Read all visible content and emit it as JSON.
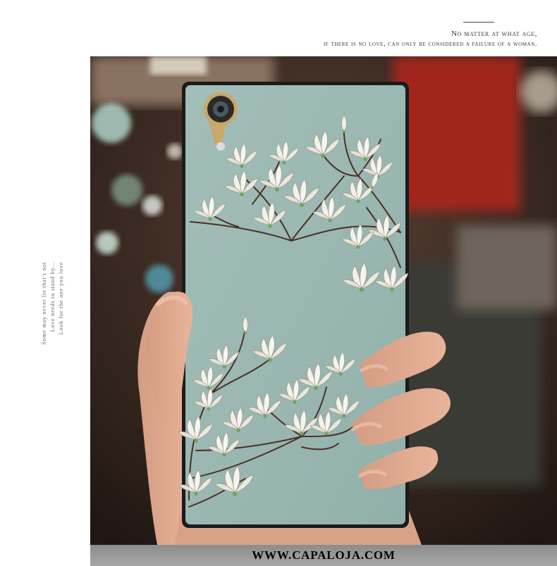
{
  "header": {
    "quote_line1": "No matter at what age,",
    "quote_line2": "if there is no love, can only be considered a failure of a woman."
  },
  "side_text": {
    "lines": [
      "Some may never lie that's not",
      "Love needs to stand by...",
      "Look for the one you love"
    ]
  },
  "photo": {
    "subject": "hand holding phone case with white magnolia print",
    "case_color": "#9ab7b1",
    "flower_color": "#f3f1ea",
    "branch_color": "#4a3028",
    "camera_ring_color": "#c9a86a"
  },
  "watermark": {
    "text": "WWW.CAPALOJA.COM"
  }
}
